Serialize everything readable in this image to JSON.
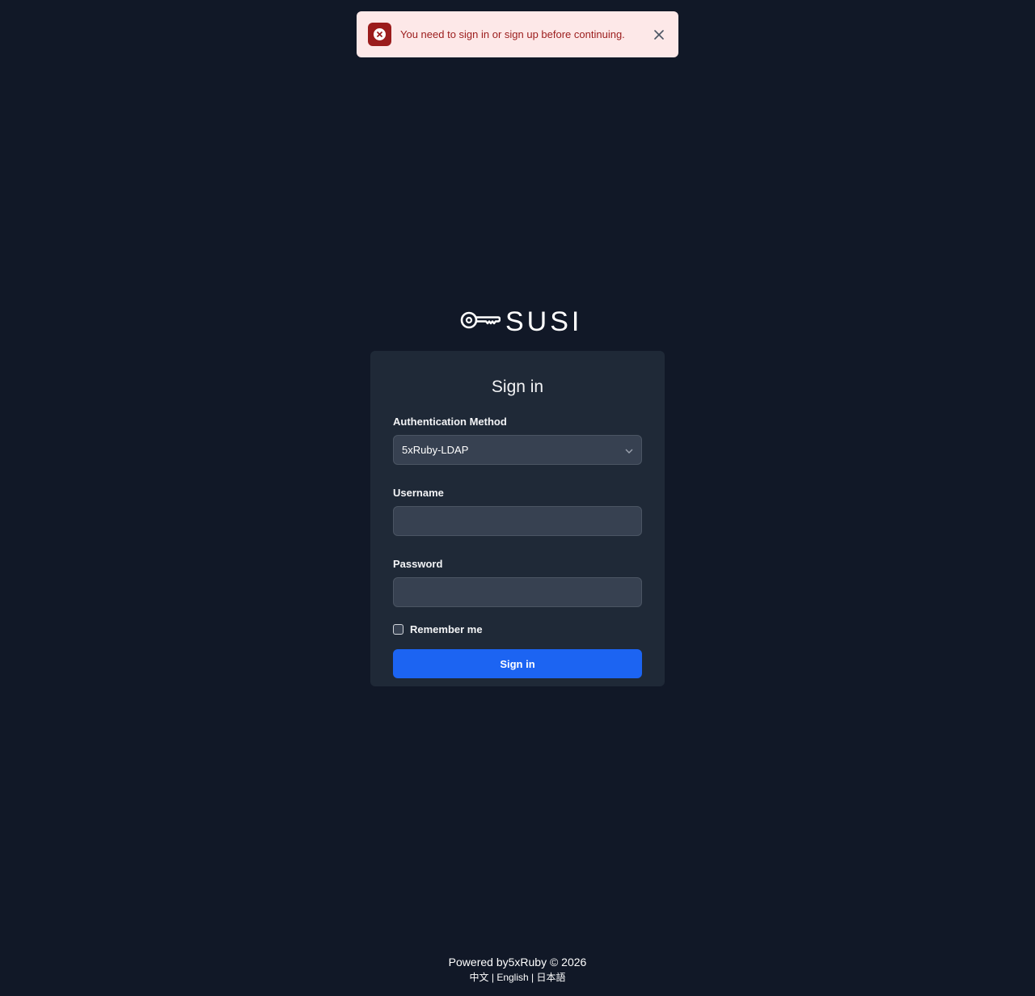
{
  "alert": {
    "message": "You need to sign in or sign up before continuing.",
    "color": "#9b1c1c",
    "icon": "x-circle-icon",
    "close_icon": "close-icon"
  },
  "logo": {
    "text": "SUSI",
    "icon": "key-icon"
  },
  "form": {
    "title": "Sign in",
    "auth_method_label": "Authentication Method",
    "auth_method_value": "5xRuby-LDAP",
    "username_label": "Username",
    "username_value": "",
    "password_label": "Password",
    "password_value": "",
    "remember_label": "Remember me",
    "remember_checked": false,
    "submit_label": "Sign in",
    "submit_color": "#1c64f2"
  },
  "footer": {
    "powered_by": "Powered by5xRuby © 2026",
    "languages": [
      "中文",
      "English",
      "日本語"
    ],
    "separator": "|"
  }
}
